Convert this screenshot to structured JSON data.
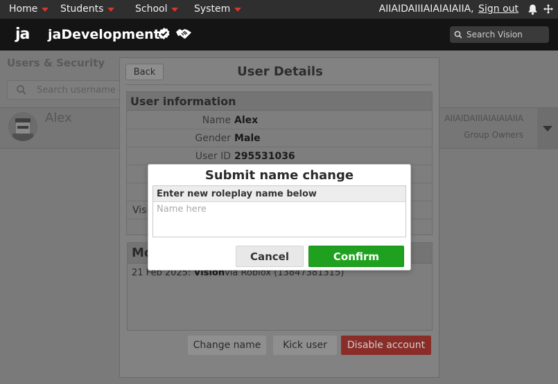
{
  "topnav": {
    "items": [
      {
        "label": "Home"
      },
      {
        "label": "Students"
      },
      {
        "label": "School"
      },
      {
        "label": "System"
      }
    ],
    "username": "AIIAIDAIIIAIAIAIAIIA,",
    "signout_label": "Sign out"
  },
  "brand": {
    "logo": "ja",
    "name": "jaDevelopment"
  },
  "search": {
    "placeholder": "Search Vision"
  },
  "background": {
    "title": "Users & Security",
    "search_placeholder": "Search username or",
    "user_name": "Alex",
    "user_tag": "AIIAIDAIIIAIAIAIAIIA",
    "user_role": "Group Owners"
  },
  "details": {
    "back_label": "Back",
    "title": "User Details",
    "info_header": "User information",
    "rows": [
      {
        "label": "Name",
        "value": "Alex"
      },
      {
        "label": "Gender",
        "value": "Male"
      },
      {
        "label": "User ID",
        "value": "295531036"
      }
    ],
    "partial_label": "Visi",
    "mod_header": "Mo",
    "mod_entry_date": "21 Feb 2025:",
    "mod_entry_source": "Vision",
    "mod_entry_detail": "via Roblox (13847381315)",
    "actions": {
      "change_name": "Change name",
      "kick_user": "Kick user",
      "disable_account": "Disable account"
    }
  },
  "dialog": {
    "title": "Submit name change",
    "field_label": "Enter new roleplay name below",
    "input_placeholder": "Name here",
    "input_value": "",
    "cancel_label": "Cancel",
    "confirm_label": "Confirm"
  },
  "colors": {
    "accent_red": "#d8352b",
    "confirm_green": "#1fa11f",
    "disable_red": "#8a2d29",
    "nav_bg": "#2f2f2f",
    "brand_bg": "#141414"
  },
  "icons": [
    "caret-down-icon",
    "bell-icon",
    "move-icon",
    "verified-badge-icon",
    "handshake-icon",
    "search-icon",
    "avatar"
  ]
}
